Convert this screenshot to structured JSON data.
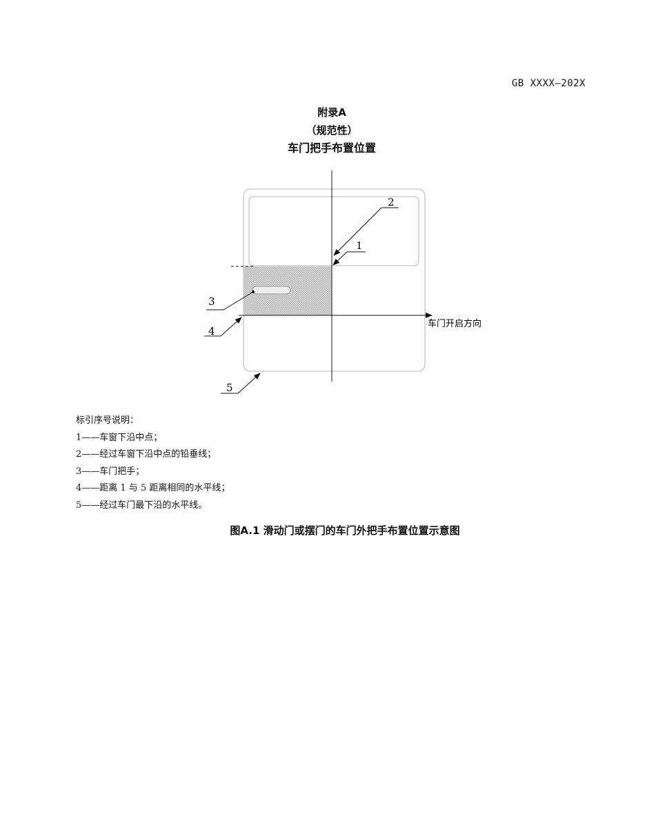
{
  "header": {
    "standard_code": "GB XXXX—202X"
  },
  "appendix": {
    "label": "附录A",
    "nature": "（规范性）",
    "title": "车门把手布置位置"
  },
  "figure": {
    "callouts": [
      "1",
      "2",
      "3",
      "4",
      "5"
    ],
    "axis_label": "车门开启方向"
  },
  "legend": {
    "title": "标引序号说明：",
    "items": [
      "1——车窗下沿中点；",
      "2——经过车窗下沿中点的铅垂线；",
      "3——车门把手；",
      "4——距离 1 与 5 距离相同的水平线；",
      "5——经过车门最下沿的水平线。"
    ]
  },
  "caption": "图A.1 滑动门或摆门的车门外把手布置位置示意图"
}
